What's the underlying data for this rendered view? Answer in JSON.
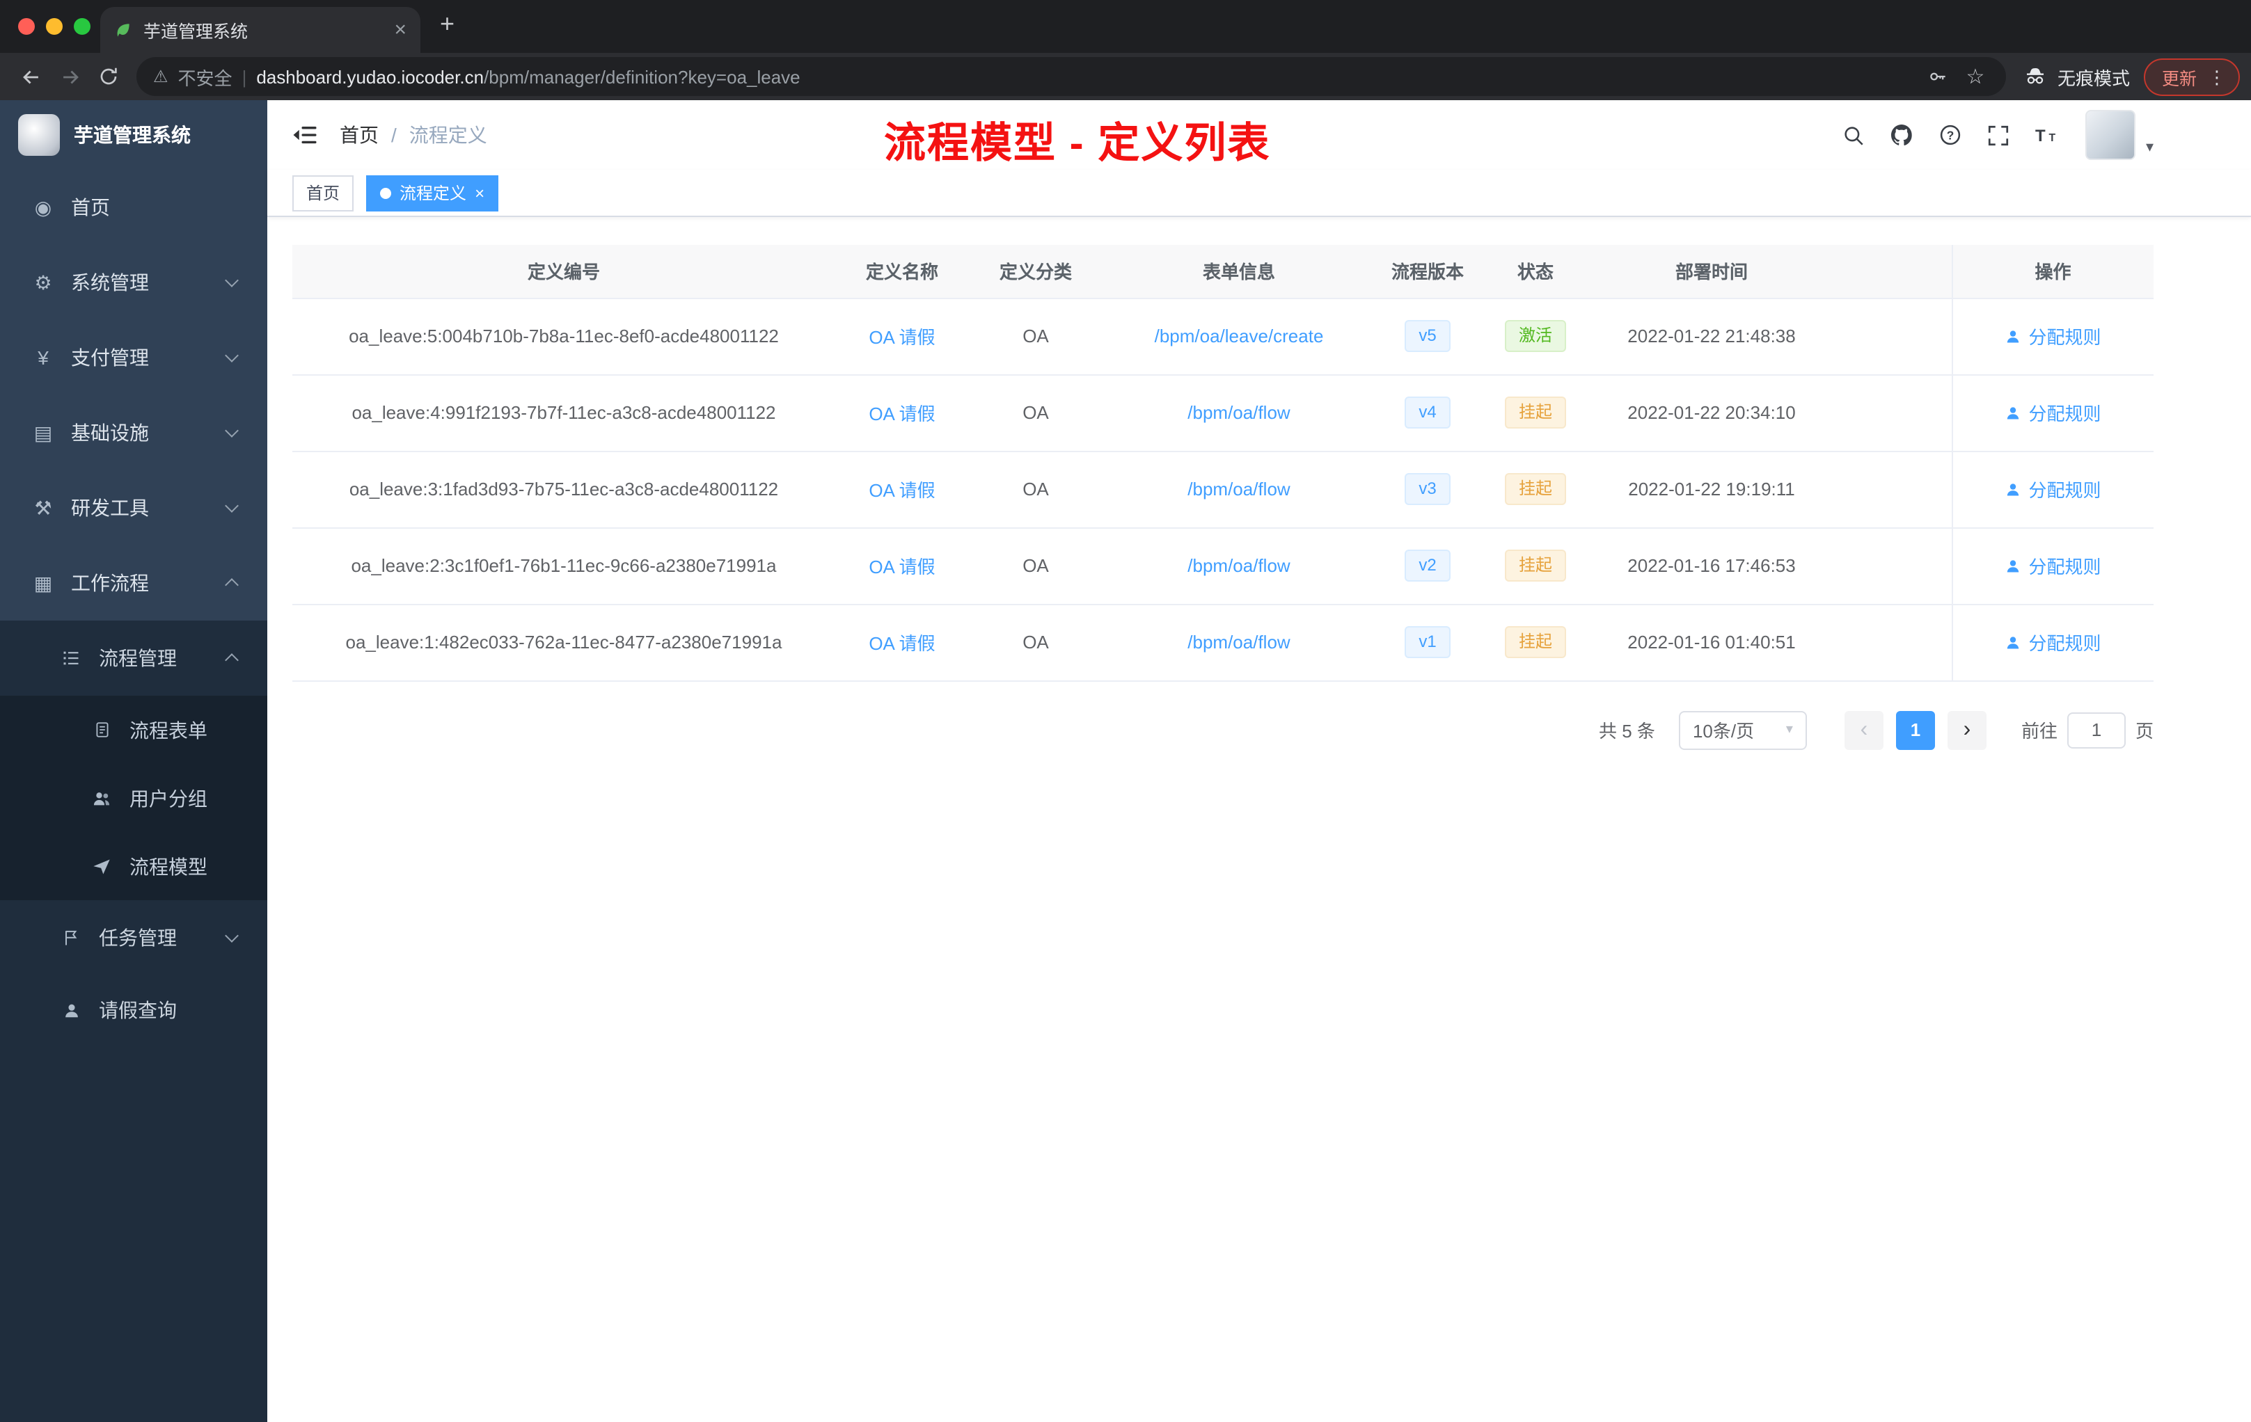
{
  "colors": {
    "primary": "#409eff",
    "annotation_red": "#f41212",
    "success_green": "#67c23a",
    "warning_orange": "#e6a23c",
    "sidebar_bg": "#304156",
    "sidebar_submenu_bg": "#1f2d3d"
  },
  "browser": {
    "tab_title": "芋道管理系统",
    "tab_close": "×",
    "new_tab": "+",
    "security_label": "不安全",
    "url_domain": "dashboard.yudao.iocoder.cn",
    "url_path": "/bpm/manager/definition?key=oa_leave",
    "incognito_label": "无痕模式",
    "update_label": "更新",
    "menu_dots": "⋮"
  },
  "sidebar": {
    "logo_title": "芋道管理系统",
    "home": "首页",
    "system": "系统管理",
    "payment": "支付管理",
    "infrastructure": "基础设施",
    "devtools": "研发工具",
    "workflow": "工作流程",
    "process_mgmt": "流程管理",
    "process_form": "流程表单",
    "user_group": "用户分组",
    "process_model": "流程模型",
    "task_mgmt": "任务管理",
    "leave_query": "请假查询"
  },
  "navbar": {
    "breadcrumb_home": "首页",
    "breadcrumb_sep": "/",
    "breadcrumb_current": "流程定义",
    "annotation_title": "流程模型 - 定义列表"
  },
  "tags": {
    "home": "首页",
    "current": "流程定义",
    "close": "×"
  },
  "table": {
    "columns": {
      "id": "定义编号",
      "name": "定义名称",
      "category": "定义分类",
      "form": "表单信息",
      "version": "流程版本",
      "status": "状态",
      "deploy_time": "部署时间",
      "filler": "",
      "action": "操作"
    },
    "rows": [
      {
        "id": "oa_leave:5:004b710b-7b8a-11ec-8ef0-acde48001122",
        "name": "OA 请假",
        "category": "OA",
        "form": "/bpm/oa/leave/create",
        "version": "v5",
        "status": "激活",
        "deploy_time": "2022-01-22 21:48:38",
        "action": "分配规则"
      },
      {
        "id": "oa_leave:4:991f2193-7b7f-11ec-a3c8-acde48001122",
        "name": "OA 请假",
        "category": "OA",
        "form": "/bpm/oa/flow",
        "version": "v4",
        "status": "挂起",
        "deploy_time": "2022-01-22 20:34:10",
        "action": "分配规则"
      },
      {
        "id": "oa_leave:3:1fad3d93-7b75-11ec-a3c8-acde48001122",
        "name": "OA 请假",
        "category": "OA",
        "form": "/bpm/oa/flow",
        "version": "v3",
        "status": "挂起",
        "deploy_time": "2022-01-22 19:19:11",
        "action": "分配规则"
      },
      {
        "id": "oa_leave:2:3c1f0ef1-76b1-11ec-9c66-a2380e71991a",
        "name": "OA 请假",
        "category": "OA",
        "form": "/bpm/oa/flow",
        "version": "v2",
        "status": "挂起",
        "deploy_time": "2022-01-16 17:46:53",
        "action": "分配规则"
      },
      {
        "id": "oa_leave:1:482ec033-762a-11ec-8477-a2380e71991a",
        "name": "OA 请假",
        "category": "OA",
        "form": "/bpm/oa/flow",
        "version": "v1",
        "status": "挂起",
        "deploy_time": "2022-01-16 01:40:51",
        "action": "分配规则"
      }
    ]
  },
  "pagination": {
    "total": "共 5 条",
    "page_size": "10条/页",
    "prev": "‹",
    "current_page": "1",
    "next": "›",
    "goto_label": "前往",
    "goto_value": "1",
    "page_unit": "页"
  },
  "icons": {
    "dashboard": "◉",
    "system": "⚙",
    "payment": "¥",
    "infrastructure": "▤",
    "devtools": "⚒",
    "workflow": "▦",
    "warning": "⚠",
    "star": "☆",
    "caret_down": "▾"
  }
}
